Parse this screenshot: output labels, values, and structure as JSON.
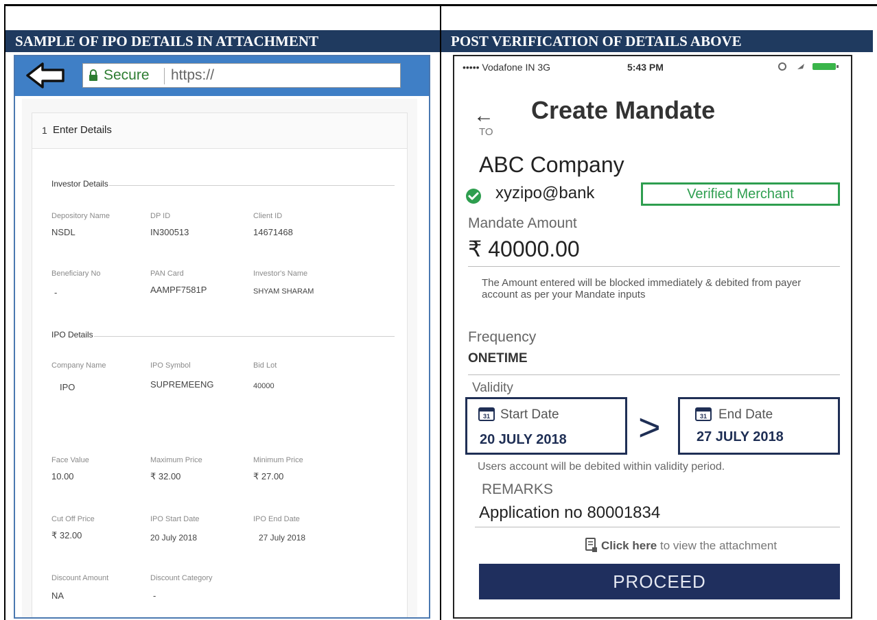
{
  "headers": {
    "left": "SAMPLE OF IPO DETAILS IN ATTACHMENT",
    "right": "POST VERIFICATION OF DETAILS ABOVE"
  },
  "browser": {
    "secure_label": "Secure",
    "url": "https://"
  },
  "ipo_form": {
    "step_number": "1",
    "step_title": "Enter Details",
    "investor_section": "Investor Details",
    "investor_fields": [
      {
        "label": "Depository Name",
        "value": "NSDL"
      },
      {
        "label": "DP ID",
        "value": "IN300513"
      },
      {
        "label": "Client ID",
        "value": "14671468"
      },
      {
        "label": "Beneficiary No",
        "value": "-"
      },
      {
        "label": "PAN Card",
        "value": "AAMPF7581P"
      },
      {
        "label": "Investor's Name",
        "value": "SHYAM SHARAM"
      }
    ],
    "ipo_section": "IPO Details",
    "ipo_fields": [
      {
        "label": "Company Name",
        "value": "IPO"
      },
      {
        "label": "IPO Symbol",
        "value": "SUPREMEENG"
      },
      {
        "label": "Bid Lot",
        "value": "40000"
      },
      {
        "label": "Face Value",
        "value": "10.00"
      },
      {
        "label": "Maximum Price",
        "value": "₹ 32.00"
      },
      {
        "label": "Minimum Price",
        "value": "₹ 27.00"
      },
      {
        "label": "Cut Off Price",
        "value": "₹ 32.00"
      },
      {
        "label": "IPO Start Date",
        "value": "20 July 2018"
      },
      {
        "label": "IPO End Date",
        "value": "27 July 2018"
      },
      {
        "label": "Discount Amount",
        "value": "NA"
      },
      {
        "label": "Discount Category",
        "value": "-"
      }
    ]
  },
  "phone": {
    "carrier": "••••• Vodafone IN  3G",
    "time": "5:43 PM",
    "back_arrow": "←",
    "title": "Create Mandate",
    "to_label": "TO",
    "company": "ABC Company",
    "vpa": "xyzipo@bank",
    "verified_badge": "Verified Merchant",
    "amount_label": "Mandate Amount",
    "amount": "₹ 40000.00",
    "amount_note": "The Amount entered will be blocked immediately & debited from payer account as per your Mandate inputs",
    "frequency_label": "Frequency",
    "frequency": "ONETIME",
    "validity_label": "Validity",
    "start_label": "Start Date",
    "start_date": "20 JULY 2018",
    "end_label": "End Date",
    "end_date": "27 JULY 2018",
    "gt_sign": ">",
    "calendar_day": "31",
    "debit_note": "Users account will be debited within validity period.",
    "remarks_label": "REMARKS",
    "remarks": "Application no 80001834",
    "attach_link_bold": "Click here",
    "attach_link_rest": " to view the attachment",
    "proceed_label": "PROCEED"
  },
  "colors": {
    "header_bg": "#1f3a5f",
    "browser_bar": "#3f7fc6",
    "verified_green": "#2e9e4f",
    "navy": "#1f2f5e"
  },
  "icons": [
    "back-arrow-icon",
    "lock-icon",
    "check-circle-icon",
    "calendar-icon",
    "attachment-icon",
    "signal-icon",
    "battery-icon"
  ]
}
